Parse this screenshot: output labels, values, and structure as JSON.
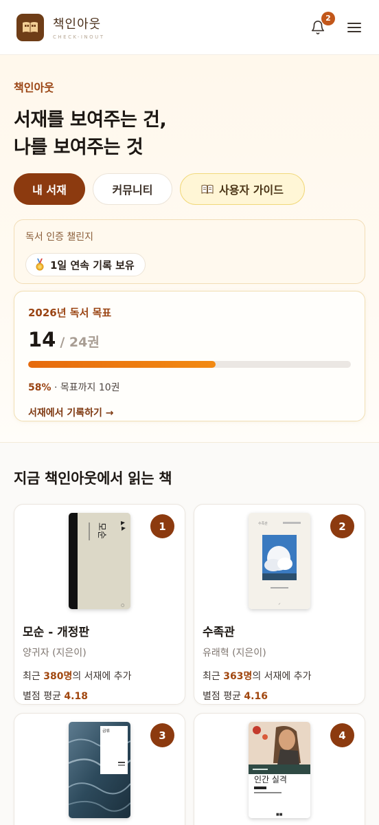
{
  "brand": {
    "name": "책인아웃",
    "sub": "CHECK-INOUT"
  },
  "notifications": {
    "count": "2"
  },
  "hero": {
    "eyebrow": "책인아웃",
    "title_line1": "서재를 보여주는 건,",
    "title_line2": "나를 보여주는 것",
    "buttons": {
      "my_library": "내 서재",
      "community": "커뮤니티",
      "guide": "사용자 가이드"
    }
  },
  "challenge": {
    "title": "독서 인증 챌린지",
    "badge": "1일 연속 기록 보유"
  },
  "goal": {
    "title": "2026년 독서 목표",
    "current": "14",
    "total": "/ 24권",
    "progress": 0.58,
    "percent": "58%",
    "remaining": "· 목표까지 10권",
    "link": "서재에서 기록하기 →"
  },
  "reading": {
    "title": "지금 책인아웃에서 읽는 책",
    "stat_prefix": "최근 ",
    "stat_suffix": "의 서재에 추가",
    "rating_prefix": "별점 평균 ",
    "books": [
      {
        "rank": "1",
        "title": "모순 - 개정판",
        "author": "양귀자 (지은이)",
        "added": "380명",
        "rating": "4.18",
        "cover_text": "모순"
      },
      {
        "rank": "2",
        "title": "수족관",
        "author": "유래혁 (지은이)",
        "added": "363명",
        "rating": "4.16",
        "cover_text": "수족관"
      },
      {
        "rank": "3",
        "cover_text": "급류"
      },
      {
        "rank": "4",
        "cover_text": "인간 실격"
      }
    ]
  },
  "colors": {
    "accent": "#8c3a0f",
    "progress": "#f07a10",
    "guide_bg": "#fff6d6"
  },
  "icons": [
    "book-logo-icon",
    "bell-icon",
    "hamburger-menu-icon",
    "open-book-icon",
    "medal-icon"
  ]
}
